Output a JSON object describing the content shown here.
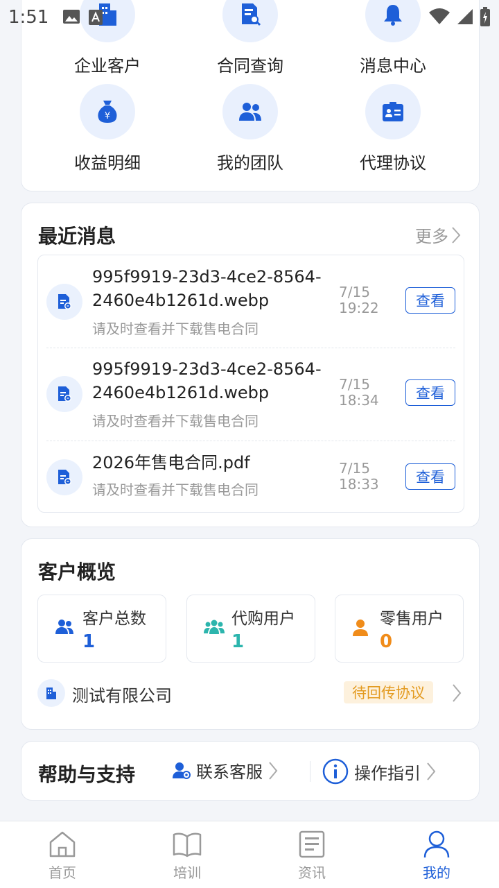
{
  "status_bar": {
    "time": "1:51"
  },
  "grid": {
    "items": [
      {
        "label": "企业客户",
        "icon": "building-icon"
      },
      {
        "label": "合同查询",
        "icon": "document-search-icon"
      },
      {
        "label": "消息中心",
        "icon": "bell-icon"
      },
      {
        "label": "收益明细",
        "icon": "money-bag-icon"
      },
      {
        "label": "我的团队",
        "icon": "team-icon"
      },
      {
        "label": "代理协议",
        "icon": "id-card-icon"
      }
    ]
  },
  "messages": {
    "title": "最近消息",
    "more_label": "更多",
    "items": [
      {
        "title": "995f9919-23d3-4ce2-8564-2460e4b1261d.webp",
        "subtitle": "请及时查看并下载售电合同",
        "date": "7/15",
        "time": "19:22",
        "action": "查看"
      },
      {
        "title": "995f9919-23d3-4ce2-8564-2460e4b1261d.webp",
        "subtitle": "请及时查看并下载售电合同",
        "date": "7/15",
        "time": "18:34",
        "action": "查看"
      },
      {
        "title": "2026年售电合同.pdf",
        "subtitle": "请及时查看并下载售电合同",
        "date": "7/15",
        "time": "18:33",
        "action": "查看"
      }
    ]
  },
  "customers": {
    "title": "客户概览",
    "stats": [
      {
        "label": "客户总数",
        "value": "1",
        "color": "#1e5fd8"
      },
      {
        "label": "代购用户",
        "value": "1",
        "color": "#2cb5ad"
      },
      {
        "label": "零售用户",
        "value": "0",
        "color": "#f08c1a"
      }
    ],
    "company": {
      "name": "测试有限公司",
      "status": "待回传协议"
    }
  },
  "help": {
    "title": "帮助与支持",
    "contact_label": "联系客服",
    "guide_label": "操作指引"
  },
  "nav": {
    "items": [
      {
        "label": "首页"
      },
      {
        "label": "培训"
      },
      {
        "label": "资讯"
      },
      {
        "label": "我的"
      }
    ],
    "active_color": "#1e5fd8"
  }
}
